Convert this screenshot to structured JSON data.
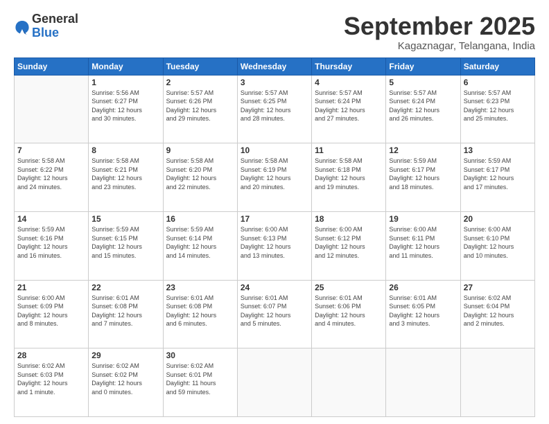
{
  "logo": {
    "general": "General",
    "blue": "Blue"
  },
  "header": {
    "month": "September 2025",
    "location": "Kagaznagar, Telangana, India"
  },
  "weekdays": [
    "Sunday",
    "Monday",
    "Tuesday",
    "Wednesday",
    "Thursday",
    "Friday",
    "Saturday"
  ],
  "weeks": [
    [
      {
        "day": "",
        "info": ""
      },
      {
        "day": "1",
        "info": "Sunrise: 5:56 AM\nSunset: 6:27 PM\nDaylight: 12 hours\nand 30 minutes."
      },
      {
        "day": "2",
        "info": "Sunrise: 5:57 AM\nSunset: 6:26 PM\nDaylight: 12 hours\nand 29 minutes."
      },
      {
        "day": "3",
        "info": "Sunrise: 5:57 AM\nSunset: 6:25 PM\nDaylight: 12 hours\nand 28 minutes."
      },
      {
        "day": "4",
        "info": "Sunrise: 5:57 AM\nSunset: 6:24 PM\nDaylight: 12 hours\nand 27 minutes."
      },
      {
        "day": "5",
        "info": "Sunrise: 5:57 AM\nSunset: 6:24 PM\nDaylight: 12 hours\nand 26 minutes."
      },
      {
        "day": "6",
        "info": "Sunrise: 5:57 AM\nSunset: 6:23 PM\nDaylight: 12 hours\nand 25 minutes."
      }
    ],
    [
      {
        "day": "7",
        "info": "Sunrise: 5:58 AM\nSunset: 6:22 PM\nDaylight: 12 hours\nand 24 minutes."
      },
      {
        "day": "8",
        "info": "Sunrise: 5:58 AM\nSunset: 6:21 PM\nDaylight: 12 hours\nand 23 minutes."
      },
      {
        "day": "9",
        "info": "Sunrise: 5:58 AM\nSunset: 6:20 PM\nDaylight: 12 hours\nand 22 minutes."
      },
      {
        "day": "10",
        "info": "Sunrise: 5:58 AM\nSunset: 6:19 PM\nDaylight: 12 hours\nand 20 minutes."
      },
      {
        "day": "11",
        "info": "Sunrise: 5:58 AM\nSunset: 6:18 PM\nDaylight: 12 hours\nand 19 minutes."
      },
      {
        "day": "12",
        "info": "Sunrise: 5:59 AM\nSunset: 6:17 PM\nDaylight: 12 hours\nand 18 minutes."
      },
      {
        "day": "13",
        "info": "Sunrise: 5:59 AM\nSunset: 6:17 PM\nDaylight: 12 hours\nand 17 minutes."
      }
    ],
    [
      {
        "day": "14",
        "info": "Sunrise: 5:59 AM\nSunset: 6:16 PM\nDaylight: 12 hours\nand 16 minutes."
      },
      {
        "day": "15",
        "info": "Sunrise: 5:59 AM\nSunset: 6:15 PM\nDaylight: 12 hours\nand 15 minutes."
      },
      {
        "day": "16",
        "info": "Sunrise: 5:59 AM\nSunset: 6:14 PM\nDaylight: 12 hours\nand 14 minutes."
      },
      {
        "day": "17",
        "info": "Sunrise: 6:00 AM\nSunset: 6:13 PM\nDaylight: 12 hours\nand 13 minutes."
      },
      {
        "day": "18",
        "info": "Sunrise: 6:00 AM\nSunset: 6:12 PM\nDaylight: 12 hours\nand 12 minutes."
      },
      {
        "day": "19",
        "info": "Sunrise: 6:00 AM\nSunset: 6:11 PM\nDaylight: 12 hours\nand 11 minutes."
      },
      {
        "day": "20",
        "info": "Sunrise: 6:00 AM\nSunset: 6:10 PM\nDaylight: 12 hours\nand 10 minutes."
      }
    ],
    [
      {
        "day": "21",
        "info": "Sunrise: 6:00 AM\nSunset: 6:09 PM\nDaylight: 12 hours\nand 8 minutes."
      },
      {
        "day": "22",
        "info": "Sunrise: 6:01 AM\nSunset: 6:08 PM\nDaylight: 12 hours\nand 7 minutes."
      },
      {
        "day": "23",
        "info": "Sunrise: 6:01 AM\nSunset: 6:08 PM\nDaylight: 12 hours\nand 6 minutes."
      },
      {
        "day": "24",
        "info": "Sunrise: 6:01 AM\nSunset: 6:07 PM\nDaylight: 12 hours\nand 5 minutes."
      },
      {
        "day": "25",
        "info": "Sunrise: 6:01 AM\nSunset: 6:06 PM\nDaylight: 12 hours\nand 4 minutes."
      },
      {
        "day": "26",
        "info": "Sunrise: 6:01 AM\nSunset: 6:05 PM\nDaylight: 12 hours\nand 3 minutes."
      },
      {
        "day": "27",
        "info": "Sunrise: 6:02 AM\nSunset: 6:04 PM\nDaylight: 12 hours\nand 2 minutes."
      }
    ],
    [
      {
        "day": "28",
        "info": "Sunrise: 6:02 AM\nSunset: 6:03 PM\nDaylight: 12 hours\nand 1 minute."
      },
      {
        "day": "29",
        "info": "Sunrise: 6:02 AM\nSunset: 6:02 PM\nDaylight: 12 hours\nand 0 minutes."
      },
      {
        "day": "30",
        "info": "Sunrise: 6:02 AM\nSunset: 6:01 PM\nDaylight: 11 hours\nand 59 minutes."
      },
      {
        "day": "",
        "info": ""
      },
      {
        "day": "",
        "info": ""
      },
      {
        "day": "",
        "info": ""
      },
      {
        "day": "",
        "info": ""
      }
    ]
  ]
}
